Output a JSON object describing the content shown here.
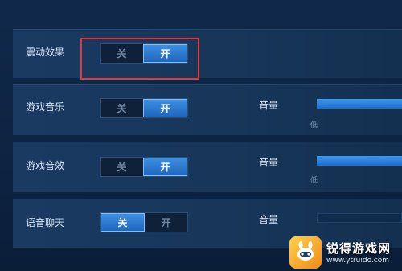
{
  "settings": [
    {
      "label": "震动效果",
      "off": "关",
      "on": "开",
      "selected": "on",
      "has_volume": false
    },
    {
      "label": "游戏音乐",
      "off": "关",
      "on": "开",
      "selected": "on",
      "has_volume": true,
      "volume_label": "音量",
      "low_label": "低",
      "volume_level": 1.0
    },
    {
      "label": "游戏音效",
      "off": "关",
      "on": "开",
      "selected": "on",
      "has_volume": true,
      "volume_label": "音量",
      "low_label": "低",
      "volume_level": 1.0
    },
    {
      "label": "语音聊天",
      "off": "关",
      "on": "开",
      "selected": "off",
      "has_volume": true,
      "volume_label": "音量",
      "low_label": "",
      "volume_level": 0.0
    }
  ],
  "watermark": {
    "title": "锐得游戏网",
    "url": "www.ytruido.com"
  },
  "colors": {
    "accent": "#2a7fd6",
    "highlight": "#e2373b",
    "background": "#10294a"
  }
}
